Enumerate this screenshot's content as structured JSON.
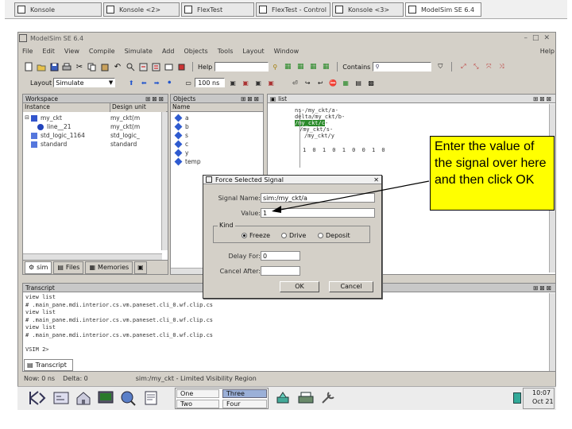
{
  "taskbar_top": {
    "tabs": [
      {
        "label": "Konsole"
      },
      {
        "label": "Konsole <2>"
      },
      {
        "label": "FlexTest"
      },
      {
        "label": "FlexTest - Control"
      },
      {
        "label": "Konsole <3>"
      },
      {
        "label": "ModelSim SE 6.4"
      }
    ]
  },
  "window": {
    "title": "ModelSim SE 6.4",
    "menu": [
      "File",
      "Edit",
      "View",
      "Compile",
      "Simulate",
      "Add",
      "Objects",
      "Tools",
      "Layout",
      "Window"
    ],
    "help_right": "Help",
    "search_label": "Help",
    "contains_label": "Contains",
    "layout_label": "Layout",
    "layout_value": "Simulate",
    "runtime_value": "100 ns"
  },
  "workspace": {
    "title": "Workspace",
    "col_instance": "Instance",
    "col_design_unit": "Design unit",
    "rows": [
      {
        "instance": "my_ckt",
        "unit": "my_ckt(m"
      },
      {
        "instance": "line__21",
        "unit": "my_ckt(m"
      },
      {
        "instance": "std_logic_1164",
        "unit": "std_logic_"
      },
      {
        "instance": "standard",
        "unit": "standard"
      }
    ],
    "tabs": [
      "sim",
      "Files",
      "Memories"
    ]
  },
  "objects": {
    "title": "Objects",
    "col_name": "Name",
    "items": [
      "a",
      "b",
      "s",
      "c",
      "y",
      "temp"
    ]
  },
  "wave": {
    "title": "list",
    "signals": [
      "/my_ckt/a",
      "/my_ckt/b",
      "/my_ckt/c",
      "/my_ckt/s",
      "/my_ckt/y"
    ],
    "values": "1 0 1 0 1 0 0 1 0"
  },
  "dialog": {
    "title": "Force Selected Signal",
    "signal_name_label": "Signal Name:",
    "signal_name_value": "sim:/my_ckt/a",
    "value_label": "Value:",
    "value_value": "1",
    "kind_label": "Kind",
    "kind_options": [
      "Freeze",
      "Drive",
      "Deposit"
    ],
    "kind_selected": "Freeze",
    "delay_label": "Delay For:",
    "delay_value": "0",
    "cancel_after_label": "Cancel After:",
    "cancel_after_value": "",
    "ok_label": "OK",
    "cancel_label": "Cancel"
  },
  "annotation": {
    "text": "Enter the value of the signal over here and then click OK"
  },
  "transcript": {
    "title": "Transcript",
    "lines": [
      "view list",
      "# .main_pane.mdi.interior.cs.vm.paneset.cli_0.wf.clip.cs",
      "view list",
      "# .main_pane.mdi.interior.cs.vm.paneset.cli_0.wf.clip.cs",
      "view list",
      "# .main_pane.mdi.interior.cs.vm.paneset.cli_0.wf.clip.cs",
      "",
      "VSIM 2>"
    ],
    "tab_label": "Transcript"
  },
  "statusbar": {
    "now": "Now: 0 ns",
    "delta": "Delta: 0",
    "limit": "sim:/my_ckt - Limited Visibility Region"
  },
  "kde_panel": {
    "desktops": [
      "One",
      "Two",
      "Three",
      "Four"
    ],
    "clock_time": "10:07",
    "clock_date": "Oct 21"
  }
}
